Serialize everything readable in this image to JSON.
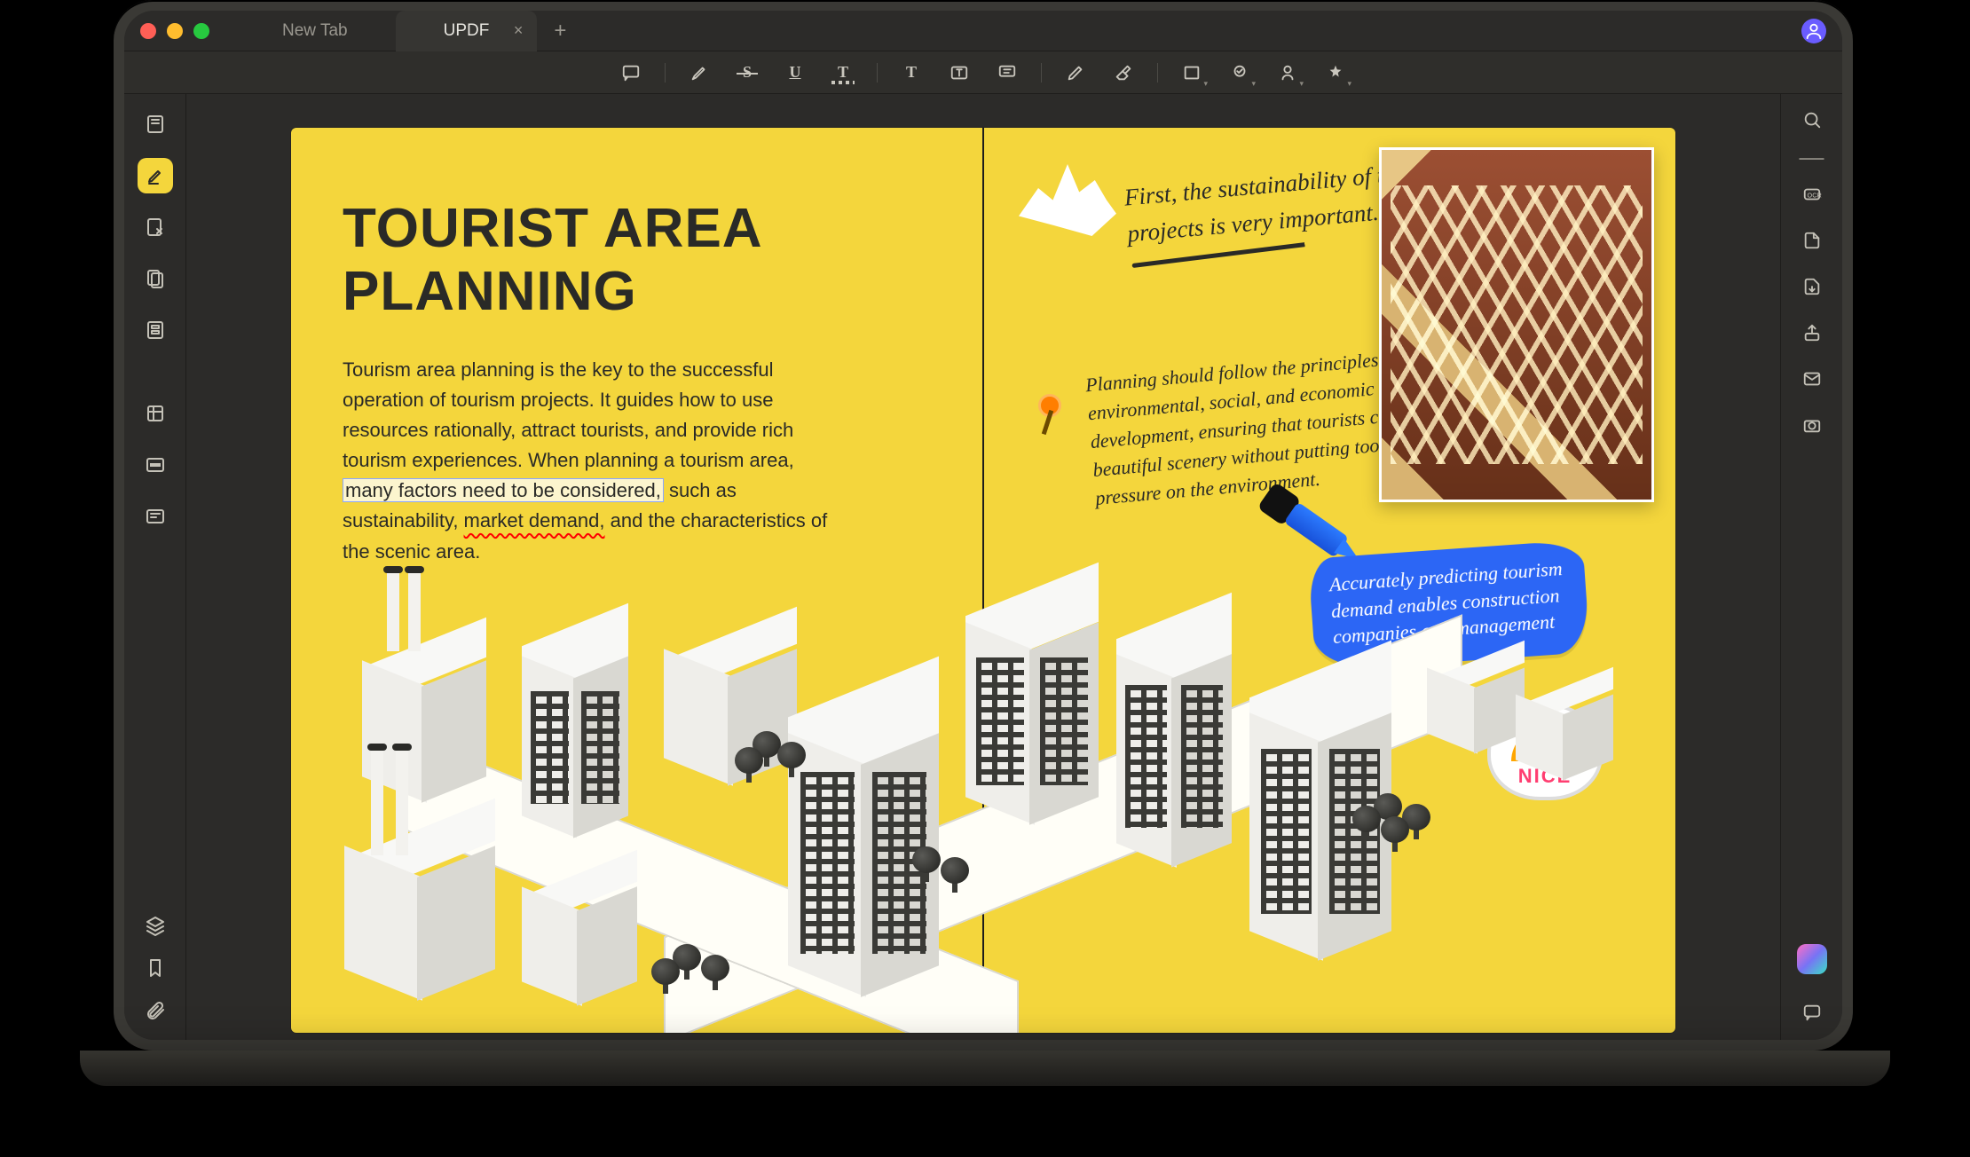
{
  "tabs": {
    "inactive_label": "New Tab",
    "active_label": "UPDF"
  },
  "top_toolbar": {
    "items": [
      "comment",
      "divider",
      "highlighter",
      "strikethrough",
      "underline",
      "squiggly",
      "divider",
      "text",
      "textbox",
      "callout",
      "divider",
      "pencil",
      "eraser",
      "divider",
      "shape",
      "stamp",
      "signature",
      "sticker"
    ]
  },
  "left_sidebar": {
    "items": [
      "reader",
      "annotate",
      "edit",
      "page-organize",
      "form",
      "crop",
      "redact",
      "ocr"
    ],
    "bottom": [
      "layers",
      "bookmark",
      "attachment"
    ],
    "active": "annotate"
  },
  "right_sidebar": {
    "items": [
      "search",
      "collapse",
      "ocr",
      "file",
      "export",
      "share",
      "mail",
      "screenshot"
    ],
    "bottom": [
      "ai",
      "chat"
    ]
  },
  "doc": {
    "title": "TOURIST AREA PLANNING",
    "para_pre": "Tourism area planning is the key to the successful operation of tourism projects.  It guides how to use resources rationally, attract tourists, and provide rich tourism experiences. When planning a tourism area, ",
    "para_hl": "many factors need to be considered,",
    "para_mid": " such as sustainability, ",
    "para_sq": "market demand,",
    "para_post": " and the characteristics of the scenic area."
  },
  "notes": {
    "hand1": "First, the sustainability of tourism projects is very important.",
    "hand2": "Planning should follow the principles of environmental, social, and economic sustainable development, ensuring that tourists can enjoy the beautiful scenery without putting too much pressure on the environment.",
    "blue": "Accurately predicting tourism demand enables construction companies and management",
    "nice": "NICE"
  }
}
